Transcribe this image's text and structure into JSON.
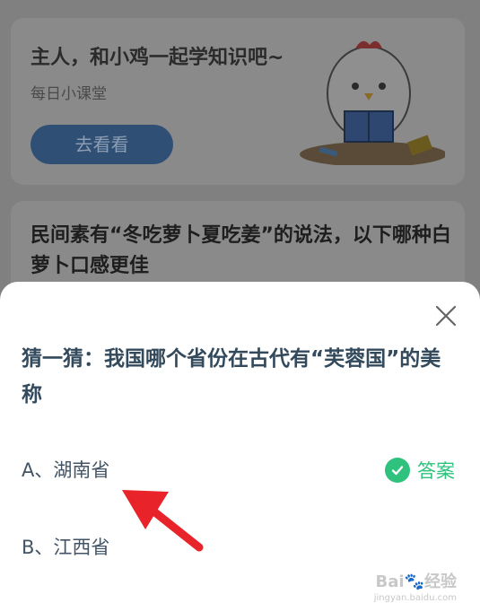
{
  "lesson_card": {
    "title": "主人，和小鸡一起学知识吧~",
    "subtitle": "每日小课堂",
    "button_label": "去看看"
  },
  "question_card": {
    "title": "民间素有“冬吃萝卜夏吃姜”的说法，以下哪种白萝卜口感更佳"
  },
  "quiz_sheet": {
    "question": "猜一猜：我国哪个省份在古代有“芙蓉国”的美称",
    "options": [
      {
        "label": "A、湖南省"
      },
      {
        "label": "B、江西省"
      }
    ],
    "answer_label": "答案",
    "close_icon": "close-icon"
  },
  "watermark": {
    "text": "Bai🐾经验",
    "url": "jingyan.baidu.com"
  },
  "colors": {
    "accent_green": "#2ec27e",
    "arrow_red": "#e8232a",
    "question_text": "#33495c"
  }
}
